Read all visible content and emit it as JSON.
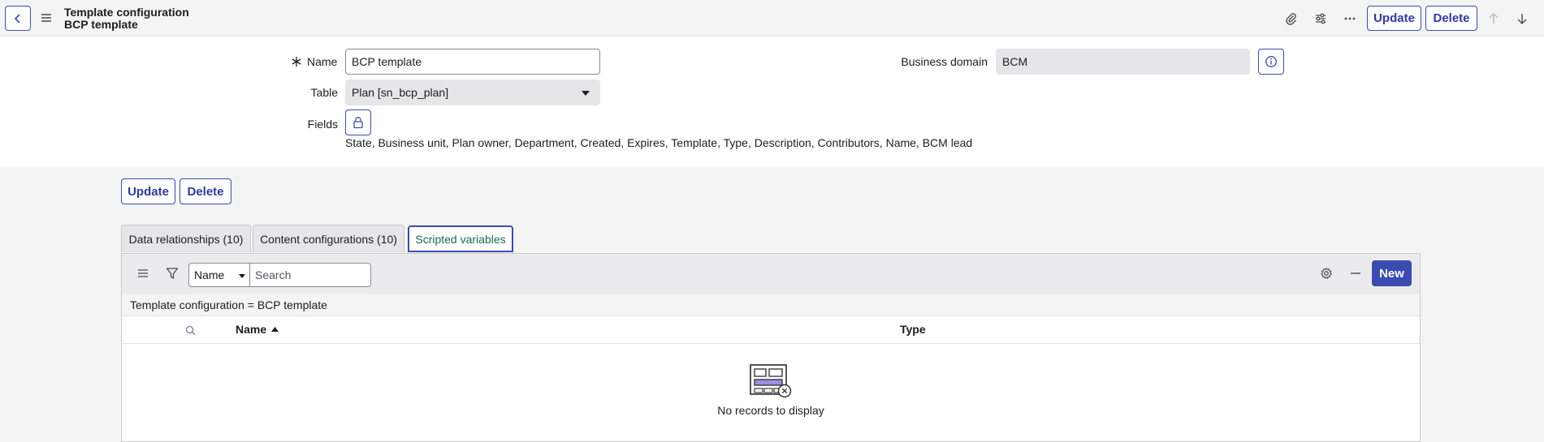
{
  "header": {
    "title_line1": "Template configuration",
    "title_line2": "BCP template",
    "update_label": "Update",
    "delete_label": "Delete"
  },
  "form": {
    "name_label": "Name",
    "name_value": "BCP template",
    "table_label": "Table",
    "table_value": "Plan [sn_bcp_plan]",
    "fields_label": "Fields",
    "fields_value": "State, Business unit, Plan owner, Department, Created, Expires, Template, Type, Description, Contributors, Name, BCM lead",
    "business_domain_label": "Business domain",
    "business_domain_value": "BCM"
  },
  "actions": {
    "update_label": "Update",
    "delete_label": "Delete"
  },
  "tabs": [
    {
      "label": "Data relationships (10)"
    },
    {
      "label": "Content configurations (10)"
    },
    {
      "label": "Scripted variables"
    }
  ],
  "list": {
    "search_field_selected": "Name",
    "search_placeholder": "Search",
    "new_label": "New",
    "filter_text": "Template configuration = BCP template",
    "columns": [
      "Name",
      "Type"
    ],
    "empty_text": "No records to display"
  },
  "colors": {
    "accent": "#3c4bb0",
    "active_tab_text": "#1b6b48"
  }
}
